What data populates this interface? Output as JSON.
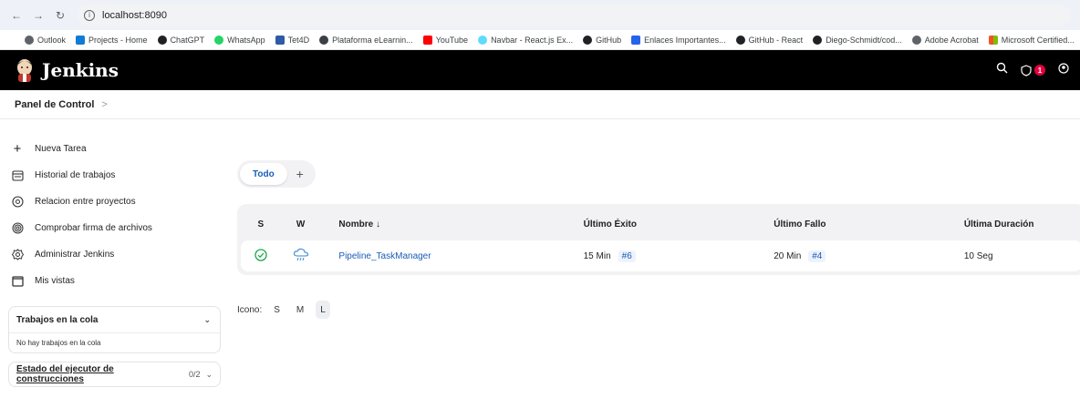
{
  "browser": {
    "url": "localhost:8090"
  },
  "bookmarks": [
    {
      "label": "Outlook",
      "color": "#5f6368"
    },
    {
      "label": "Projects - Home",
      "color": "#0f7bd6"
    },
    {
      "label": "ChatGPT",
      "color": "#202124"
    },
    {
      "label": "WhatsApp",
      "color": "#25d366"
    },
    {
      "label": "Tet4D",
      "color": "#2f5aa8"
    },
    {
      "label": "Plataforma eLearnin...",
      "color": "#3c4043"
    },
    {
      "label": "YouTube",
      "color": "#ff0000"
    },
    {
      "label": "Navbar - React.js Ex...",
      "color": "#61dafb"
    },
    {
      "label": "GitHub",
      "color": "#202124"
    },
    {
      "label": "Enlaces Importantes...",
      "color": "#2563eb"
    },
    {
      "label": "GitHub - React",
      "color": "#202124"
    },
    {
      "label": "Diego-Schmidt/cod...",
      "color": "#202124"
    },
    {
      "label": "Adobe Acrobat",
      "color": "#5f6368"
    },
    {
      "label": "Microsoft Certified...",
      "color": "#f35325"
    }
  ],
  "header": {
    "brand": "Jenkins",
    "notifications": "1"
  },
  "breadcrumb": {
    "root": "Panel de Control",
    "sep": ">"
  },
  "sidebar": {
    "tasks": [
      {
        "label": "Nueva Tarea",
        "icon": "+"
      },
      {
        "label": "Historial de trabajos",
        "icon": "▤"
      },
      {
        "label": "Relacion entre proyectos",
        "icon": "◎"
      },
      {
        "label": "Comprobar firma de archivos",
        "icon": "⊚"
      },
      {
        "label": "Administrar Jenkins",
        "icon": "⚙"
      },
      {
        "label": "Mis vistas",
        "icon": "▭"
      }
    ],
    "queue": {
      "title": "Trabajos en la cola",
      "empty": "No hay trabajos en la cola",
      "arrow": "⌄"
    },
    "executors": {
      "title": "Estado del ejecutor de construcciones",
      "count": "0/2",
      "arrow": "⌄"
    }
  },
  "views": {
    "active": "Todo",
    "add": "+"
  },
  "table": {
    "headers": {
      "s": "S",
      "w": "W",
      "name": "Nombre ↓",
      "success": "Último Éxito",
      "failure": "Último Fallo",
      "duration": "Última Duración"
    },
    "rows": [
      {
        "name": "Pipeline_TaskManager",
        "success_time": "15 Min",
        "success_build": "#6",
        "failure_time": "20 Min",
        "failure_build": "#4",
        "duration": "10 Seg"
      }
    ]
  },
  "icon_size": {
    "label": "Icono:",
    "options": [
      "S",
      "M",
      "L"
    ],
    "selected": "L"
  }
}
